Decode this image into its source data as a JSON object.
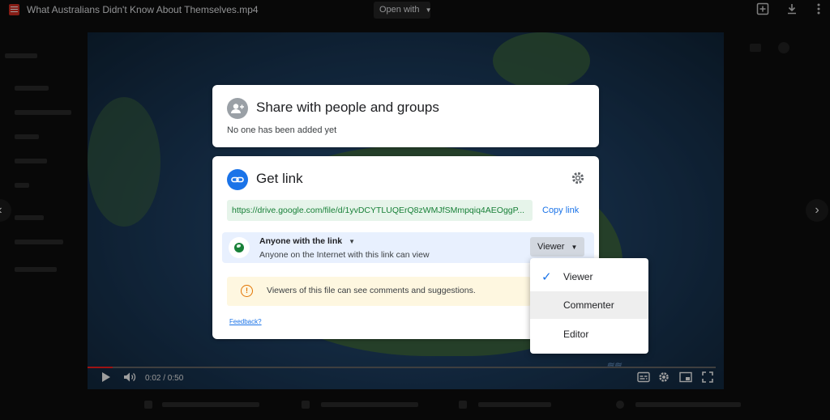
{
  "topbar": {
    "file_title": "What Australians Didn't Know About Themselves.mp4",
    "open_with_label": "Open with",
    "icons": [
      "add-to-drive-icon",
      "download-icon",
      "more-vert-icon"
    ]
  },
  "player": {
    "time": "0:02 / 0:50",
    "progress": 0.04,
    "icons": [
      "play-icon",
      "volume-icon",
      "subtitles-icon",
      "settings-icon",
      "miniplayer-icon",
      "fullscreen-icon"
    ]
  },
  "share": {
    "title": "Share with people and groups",
    "subtitle": "No one has been added yet"
  },
  "get_link": {
    "title": "Get link",
    "url": "https://drive.google.com/file/d/1yvDCYTLUQErQ8zWMJfSMmpqiq4AEOggP...",
    "copy_label": "Copy link",
    "access_title": "Anyone with the link",
    "access_subtitle": "Anyone on the Internet with this link can view",
    "role_label": "Viewer",
    "info_text": "Viewers of this file can see comments and suggestions.",
    "feedback_label": "Feedback?"
  },
  "role_menu": {
    "items": [
      {
        "label": "Viewer",
        "selected": true
      },
      {
        "label": "Commenter",
        "selected": false
      },
      {
        "label": "Editor",
        "selected": false
      }
    ]
  },
  "colors": {
    "accent": "#1a73e8",
    "link_green": "#188038",
    "link_bg": "#e6f4ea",
    "access_bg": "#e8f0fe",
    "warning_bg": "#fef7e0",
    "warning_icon": "#e37400"
  }
}
